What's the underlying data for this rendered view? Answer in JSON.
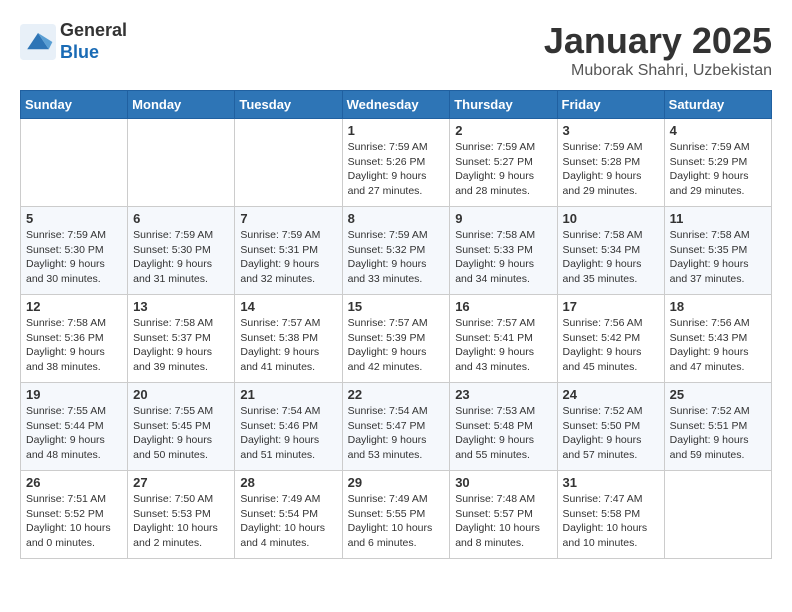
{
  "logo": {
    "general": "General",
    "blue": "Blue"
  },
  "title": "January 2025",
  "subtitle": "Muborak Shahri, Uzbekistan",
  "days_of_week": [
    "Sunday",
    "Monday",
    "Tuesday",
    "Wednesday",
    "Thursday",
    "Friday",
    "Saturday"
  ],
  "weeks": [
    [
      {
        "day": "",
        "sunrise": "",
        "sunset": "",
        "daylight": ""
      },
      {
        "day": "",
        "sunrise": "",
        "sunset": "",
        "daylight": ""
      },
      {
        "day": "",
        "sunrise": "",
        "sunset": "",
        "daylight": ""
      },
      {
        "day": "1",
        "sunrise": "Sunrise: 7:59 AM",
        "sunset": "Sunset: 5:26 PM",
        "daylight": "Daylight: 9 hours and 27 minutes."
      },
      {
        "day": "2",
        "sunrise": "Sunrise: 7:59 AM",
        "sunset": "Sunset: 5:27 PM",
        "daylight": "Daylight: 9 hours and 28 minutes."
      },
      {
        "day": "3",
        "sunrise": "Sunrise: 7:59 AM",
        "sunset": "Sunset: 5:28 PM",
        "daylight": "Daylight: 9 hours and 29 minutes."
      },
      {
        "day": "4",
        "sunrise": "Sunrise: 7:59 AM",
        "sunset": "Sunset: 5:29 PM",
        "daylight": "Daylight: 9 hours and 29 minutes."
      }
    ],
    [
      {
        "day": "5",
        "sunrise": "Sunrise: 7:59 AM",
        "sunset": "Sunset: 5:30 PM",
        "daylight": "Daylight: 9 hours and 30 minutes."
      },
      {
        "day": "6",
        "sunrise": "Sunrise: 7:59 AM",
        "sunset": "Sunset: 5:30 PM",
        "daylight": "Daylight: 9 hours and 31 minutes."
      },
      {
        "day": "7",
        "sunrise": "Sunrise: 7:59 AM",
        "sunset": "Sunset: 5:31 PM",
        "daylight": "Daylight: 9 hours and 32 minutes."
      },
      {
        "day": "8",
        "sunrise": "Sunrise: 7:59 AM",
        "sunset": "Sunset: 5:32 PM",
        "daylight": "Daylight: 9 hours and 33 minutes."
      },
      {
        "day": "9",
        "sunrise": "Sunrise: 7:58 AM",
        "sunset": "Sunset: 5:33 PM",
        "daylight": "Daylight: 9 hours and 34 minutes."
      },
      {
        "day": "10",
        "sunrise": "Sunrise: 7:58 AM",
        "sunset": "Sunset: 5:34 PM",
        "daylight": "Daylight: 9 hours and 35 minutes."
      },
      {
        "day": "11",
        "sunrise": "Sunrise: 7:58 AM",
        "sunset": "Sunset: 5:35 PM",
        "daylight": "Daylight: 9 hours and 37 minutes."
      }
    ],
    [
      {
        "day": "12",
        "sunrise": "Sunrise: 7:58 AM",
        "sunset": "Sunset: 5:36 PM",
        "daylight": "Daylight: 9 hours and 38 minutes."
      },
      {
        "day": "13",
        "sunrise": "Sunrise: 7:58 AM",
        "sunset": "Sunset: 5:37 PM",
        "daylight": "Daylight: 9 hours and 39 minutes."
      },
      {
        "day": "14",
        "sunrise": "Sunrise: 7:57 AM",
        "sunset": "Sunset: 5:38 PM",
        "daylight": "Daylight: 9 hours and 41 minutes."
      },
      {
        "day": "15",
        "sunrise": "Sunrise: 7:57 AM",
        "sunset": "Sunset: 5:39 PM",
        "daylight": "Daylight: 9 hours and 42 minutes."
      },
      {
        "day": "16",
        "sunrise": "Sunrise: 7:57 AM",
        "sunset": "Sunset: 5:41 PM",
        "daylight": "Daylight: 9 hours and 43 minutes."
      },
      {
        "day": "17",
        "sunrise": "Sunrise: 7:56 AM",
        "sunset": "Sunset: 5:42 PM",
        "daylight": "Daylight: 9 hours and 45 minutes."
      },
      {
        "day": "18",
        "sunrise": "Sunrise: 7:56 AM",
        "sunset": "Sunset: 5:43 PM",
        "daylight": "Daylight: 9 hours and 47 minutes."
      }
    ],
    [
      {
        "day": "19",
        "sunrise": "Sunrise: 7:55 AM",
        "sunset": "Sunset: 5:44 PM",
        "daylight": "Daylight: 9 hours and 48 minutes."
      },
      {
        "day": "20",
        "sunrise": "Sunrise: 7:55 AM",
        "sunset": "Sunset: 5:45 PM",
        "daylight": "Daylight: 9 hours and 50 minutes."
      },
      {
        "day": "21",
        "sunrise": "Sunrise: 7:54 AM",
        "sunset": "Sunset: 5:46 PM",
        "daylight": "Daylight: 9 hours and 51 minutes."
      },
      {
        "day": "22",
        "sunrise": "Sunrise: 7:54 AM",
        "sunset": "Sunset: 5:47 PM",
        "daylight": "Daylight: 9 hours and 53 minutes."
      },
      {
        "day": "23",
        "sunrise": "Sunrise: 7:53 AM",
        "sunset": "Sunset: 5:48 PM",
        "daylight": "Daylight: 9 hours and 55 minutes."
      },
      {
        "day": "24",
        "sunrise": "Sunrise: 7:52 AM",
        "sunset": "Sunset: 5:50 PM",
        "daylight": "Daylight: 9 hours and 57 minutes."
      },
      {
        "day": "25",
        "sunrise": "Sunrise: 7:52 AM",
        "sunset": "Sunset: 5:51 PM",
        "daylight": "Daylight: 9 hours and 59 minutes."
      }
    ],
    [
      {
        "day": "26",
        "sunrise": "Sunrise: 7:51 AM",
        "sunset": "Sunset: 5:52 PM",
        "daylight": "Daylight: 10 hours and 0 minutes."
      },
      {
        "day": "27",
        "sunrise": "Sunrise: 7:50 AM",
        "sunset": "Sunset: 5:53 PM",
        "daylight": "Daylight: 10 hours and 2 minutes."
      },
      {
        "day": "28",
        "sunrise": "Sunrise: 7:49 AM",
        "sunset": "Sunset: 5:54 PM",
        "daylight": "Daylight: 10 hours and 4 minutes."
      },
      {
        "day": "29",
        "sunrise": "Sunrise: 7:49 AM",
        "sunset": "Sunset: 5:55 PM",
        "daylight": "Daylight: 10 hours and 6 minutes."
      },
      {
        "day": "30",
        "sunrise": "Sunrise: 7:48 AM",
        "sunset": "Sunset: 5:57 PM",
        "daylight": "Daylight: 10 hours and 8 minutes."
      },
      {
        "day": "31",
        "sunrise": "Sunrise: 7:47 AM",
        "sunset": "Sunset: 5:58 PM",
        "daylight": "Daylight: 10 hours and 10 minutes."
      },
      {
        "day": "",
        "sunrise": "",
        "sunset": "",
        "daylight": ""
      }
    ]
  ]
}
